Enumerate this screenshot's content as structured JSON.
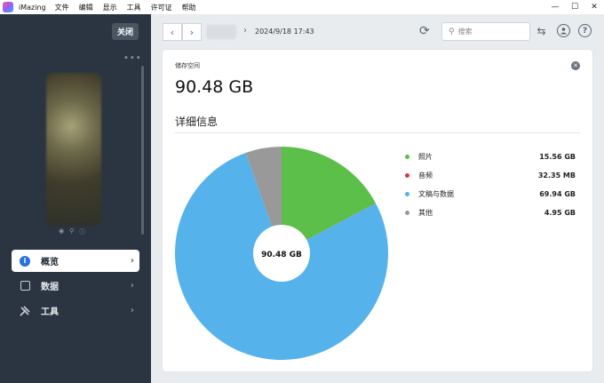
{
  "app": {
    "name": "iMazing",
    "menu": [
      "文件",
      "编辑",
      "显示",
      "工具",
      "许可证",
      "帮助"
    ],
    "window_controls": [
      "—",
      "☐",
      "✕"
    ]
  },
  "sidebar": {
    "close_label": "关闭",
    "more_label": "•••",
    "device_icons": [
      "◉",
      "⚲",
      "ⓘ"
    ],
    "nav": [
      {
        "label": "概览",
        "icon": "info-icon",
        "active": true
      },
      {
        "label": "数据",
        "icon": "square-icon",
        "active": false
      },
      {
        "label": "工具",
        "icon": "tools-icon",
        "active": false
      }
    ]
  },
  "toolbar": {
    "back": "‹",
    "forward": "›",
    "separator": "›",
    "datetime": "2024/9/18 17:43",
    "search_placeholder": "搜索",
    "icons": [
      "refresh-icon",
      "search-icon",
      "transfer-icon",
      "account-icon",
      "help-icon"
    ]
  },
  "storage": {
    "label": "储存空间",
    "total": "90.48 GB",
    "detail_title": "详细信息"
  },
  "chart_data": {
    "type": "pie",
    "center_label": "90.48 GB",
    "slices": [
      {
        "name": "照片",
        "value": 15.56,
        "display": "15.56 GB",
        "color": "#5bbf4a"
      },
      {
        "name": "音频",
        "value": 0.03235,
        "display": "32.35 MB",
        "color": "#d9363e"
      },
      {
        "name": "文稿与数据",
        "value": 69.94,
        "display": "69.94 GB",
        "color": "#56b2ea"
      },
      {
        "name": "其他",
        "value": 4.95,
        "display": "4.95 GB",
        "color": "#999999"
      }
    ]
  }
}
